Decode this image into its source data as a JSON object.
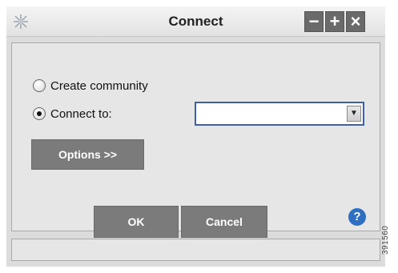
{
  "window": {
    "title": "Connect",
    "controls": {
      "minimize": "−",
      "maximize": "+",
      "close": "×"
    }
  },
  "form": {
    "option_create": {
      "label": "Create community",
      "checked": false
    },
    "option_connect": {
      "label": "Connect to:",
      "checked": true
    },
    "connect_select": {
      "value": ""
    },
    "options_button": "Options >>"
  },
  "footer": {
    "ok_label": "OK",
    "cancel_label": "Cancel",
    "help_label": "?"
  },
  "side_id": "391560",
  "colors": {
    "button_gray": "#7b7b7b",
    "help_blue": "#2f6fc1",
    "combo_border": "#3f5fa8"
  }
}
